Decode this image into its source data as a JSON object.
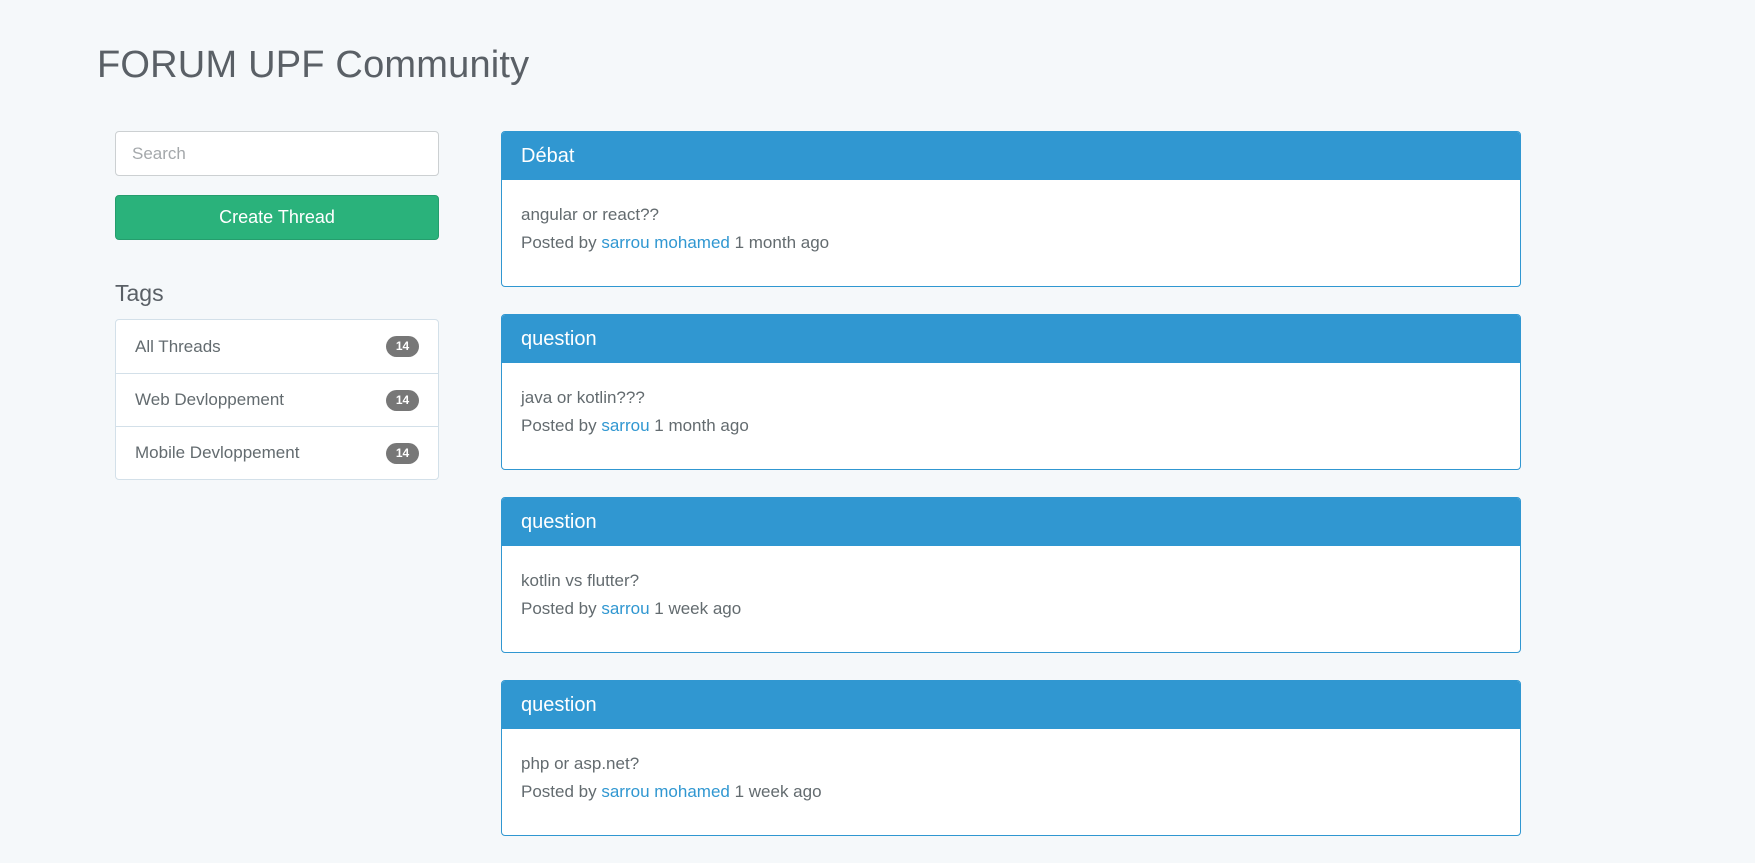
{
  "header": {
    "title": "FORUM UPF Community"
  },
  "sidebar": {
    "search_placeholder": "Search",
    "create_button": "Create Thread",
    "tags_heading": "Tags",
    "tags": [
      {
        "label": "All Threads",
        "count": "14"
      },
      {
        "label": "Web Devloppement",
        "count": "14"
      },
      {
        "label": "Mobile Devloppement",
        "count": "14"
      }
    ]
  },
  "threads": [
    {
      "tag": "Débat",
      "title": "angular or react??",
      "posted_by_label": "Posted by",
      "author": "sarrou mohamed",
      "time": "1 month ago"
    },
    {
      "tag": "question",
      "title": "java or kotlin???",
      "posted_by_label": "Posted by",
      "author": "sarrou",
      "time": "1 month ago"
    },
    {
      "tag": "question",
      "title": "kotlin vs flutter?",
      "posted_by_label": "Posted by",
      "author": "sarrou",
      "time": "1 week ago"
    },
    {
      "tag": "question",
      "title": "php or asp.net?",
      "posted_by_label": "Posted by",
      "author": "sarrou mohamed",
      "time": "1 week ago"
    }
  ],
  "colors": {
    "primary": "#3097d1",
    "success": "#2ab27b",
    "badge": "#777777",
    "background": "#f5f8fa"
  }
}
